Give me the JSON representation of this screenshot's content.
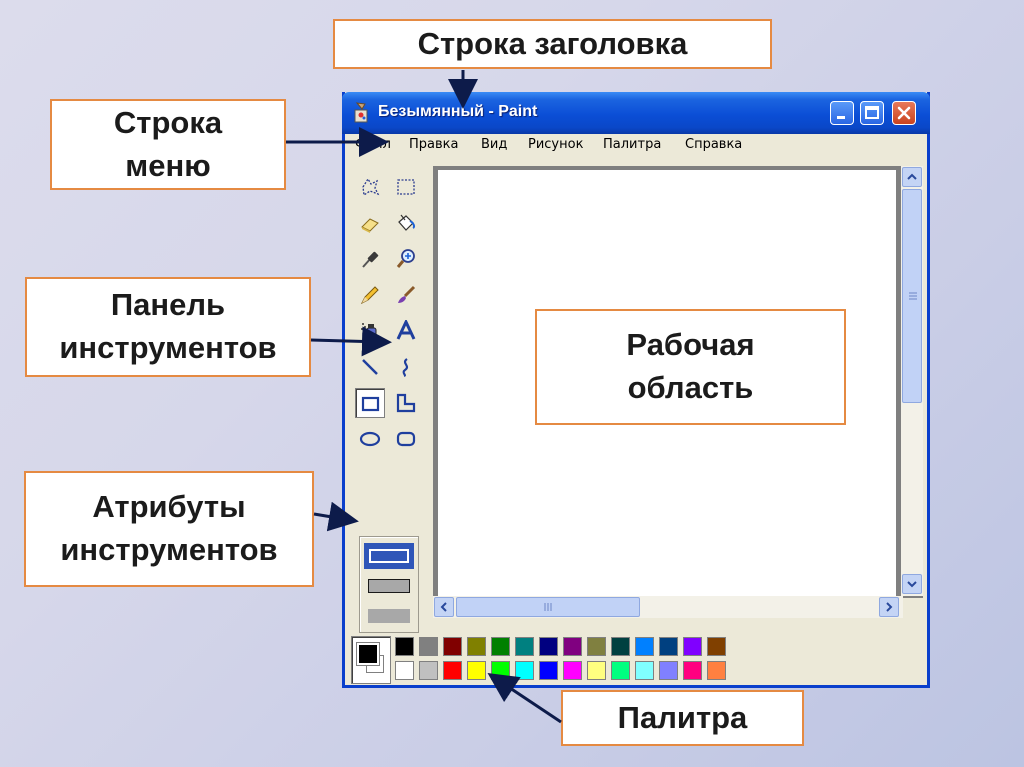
{
  "window": {
    "title": "Безымянный - Paint",
    "menu": [
      "Файл",
      "Правка",
      "Вид",
      "Рисунок",
      "Палитра",
      "Справка"
    ]
  },
  "callouts": {
    "title_bar": "Строка заголовка",
    "menu_bar_line1": "Строка",
    "menu_bar_line2": "меню",
    "toolbar_line1": "Панель",
    "toolbar_line2": "инструментов",
    "attributes_line1": "Атрибуты",
    "attributes_line2": "инструментов",
    "work_area_line1": "Рабочая",
    "work_area_line2": "область",
    "palette": "Палитра"
  },
  "tools": [
    "free-select-icon",
    "rect-select-icon",
    "eraser-icon",
    "fill-bucket-icon",
    "color-picker-icon",
    "magnifier-icon",
    "pencil-icon",
    "brush-icon",
    "airbrush-icon",
    "text-icon",
    "line-icon",
    "curve-icon",
    "rectangle-icon",
    "polygon-icon",
    "ellipse-icon",
    "rounded-rect-icon"
  ],
  "palette_colors": {
    "top": [
      "#000000",
      "#808080",
      "#800000",
      "#808000",
      "#008000",
      "#008080",
      "#000080",
      "#800080",
      "#808040",
      "#004040",
      "#0080ff",
      "#004080",
      "#8000ff",
      "#804000"
    ],
    "bottom": [
      "#ffffff",
      "#c0c0c0",
      "#ff0000",
      "#ffff00",
      "#00ff00",
      "#00ffff",
      "#0000ff",
      "#ff00ff",
      "#ffff80",
      "#00ff80",
      "#80ffff",
      "#8080ff",
      "#ff0080",
      "#ff8040"
    ]
  },
  "colors": {
    "title_bar": "#0a47c8",
    "callout_border": "#e58a42",
    "foreground": "#000000",
    "background": "#ffffff"
  }
}
